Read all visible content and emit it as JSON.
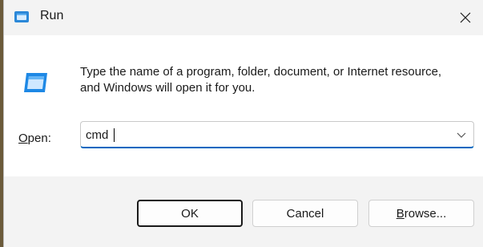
{
  "window": {
    "title": "Run",
    "close_glyph": "✕"
  },
  "dialog": {
    "icon": "run-icon",
    "description": "Type the name of a program, folder, document, or Internet resource, and Windows will open it for you.",
    "open_label_access_key": "O",
    "open_label_rest": "pen:",
    "command_value": "cmd"
  },
  "buttons": {
    "ok_label": "OK",
    "cancel_label": "Cancel",
    "browse_access_key": "B",
    "browse_rest": "rowse..."
  },
  "colors": {
    "accent": "#0067c0",
    "icon_blue": "#1e88e5"
  }
}
